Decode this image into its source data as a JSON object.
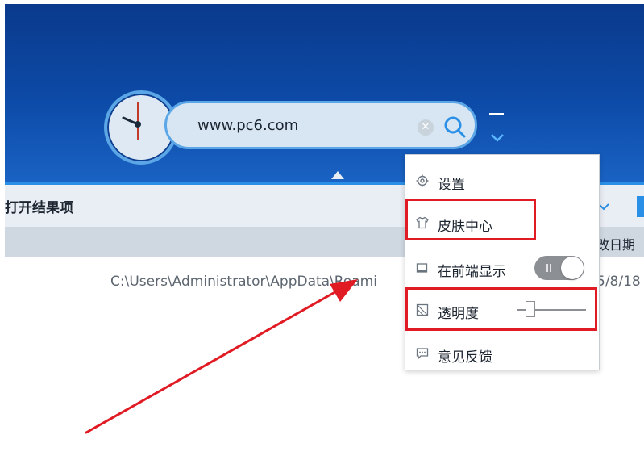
{
  "search": {
    "value": "www.pc6.com",
    "clear_glyph": "✕"
  },
  "icons": {
    "clock": "clock-icon",
    "search": "search-icon",
    "clear": "clear-icon",
    "minimize": "minimize-icon",
    "dropdown": "chevron-down-icon",
    "settings": "gear-icon",
    "skin": "shirt-icon",
    "pin": "window-icon",
    "transparency": "opacity-icon",
    "feedback": "chat-icon"
  },
  "toolbar": {
    "label": "打开结果项"
  },
  "table": {
    "date_header": "改日期",
    "rows": [
      {
        "path": "C:\\Users\\Administrator\\AppData\\Roami",
        "date": "5/8/18"
      }
    ]
  },
  "menu": {
    "items": [
      {
        "label": "设置"
      },
      {
        "label": "皮肤中心"
      },
      {
        "label": "在前端显示",
        "toggle_on": true
      },
      {
        "label": "透明度",
        "slider_value": 0.15
      },
      {
        "label": "意见反馈"
      }
    ]
  },
  "colors": {
    "header_dark": "#0a3a8c",
    "header_light": "#1a63c4",
    "accent": "#2a8fe6",
    "highlight": "#e01b24"
  }
}
